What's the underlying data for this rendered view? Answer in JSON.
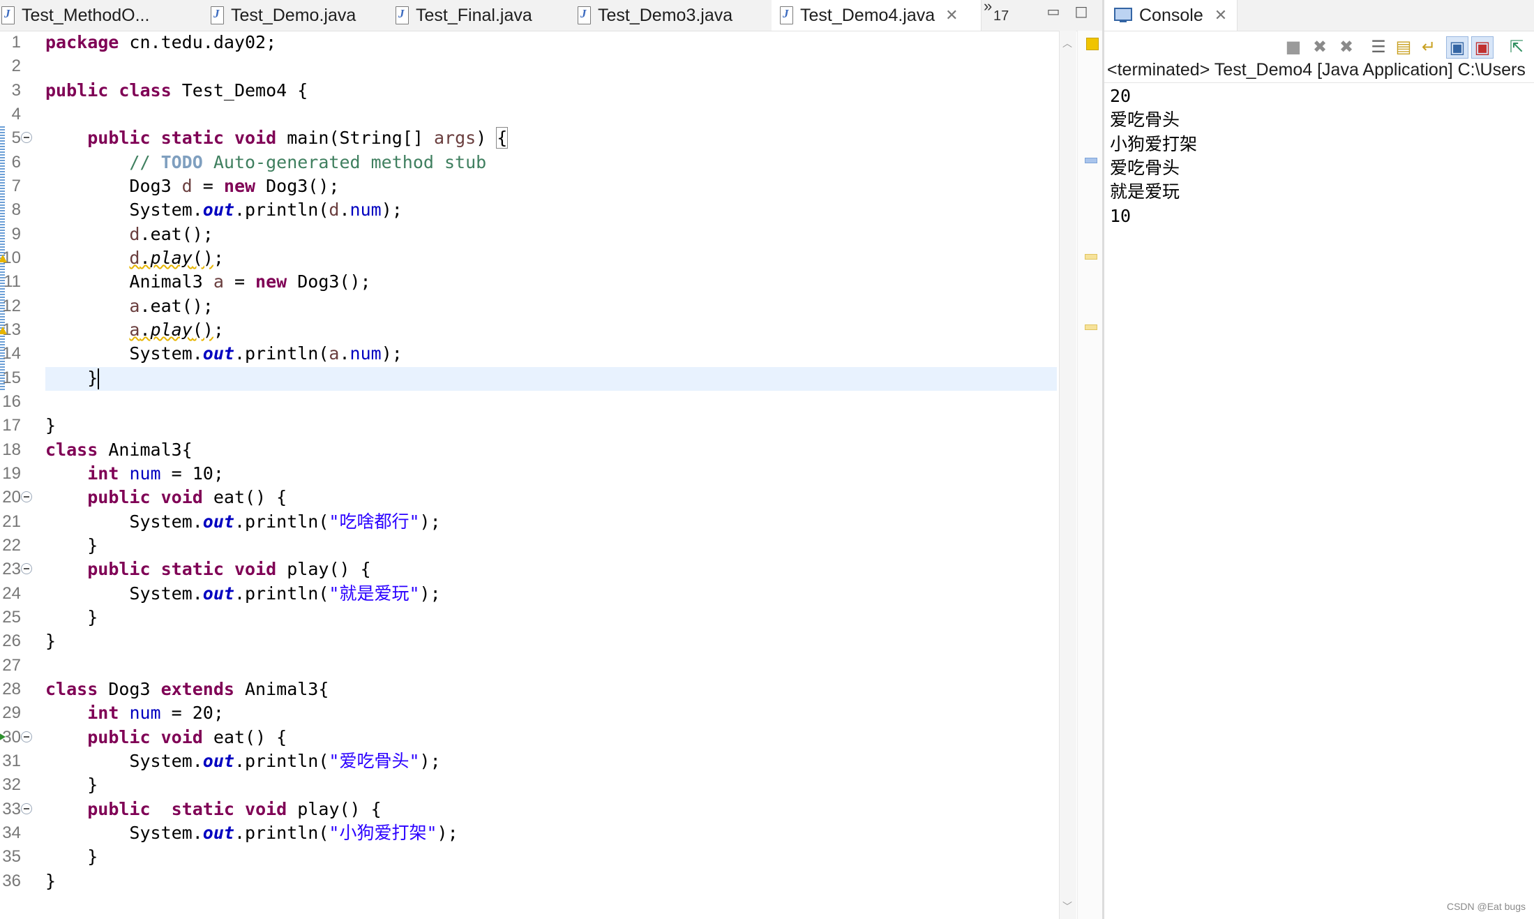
{
  "editor": {
    "tabs": [
      {
        "label": "Test_MethodO..."
      },
      {
        "label": "Test_Demo.java"
      },
      {
        "label": "Test_Final.java"
      },
      {
        "label": "Test_Demo3.java"
      },
      {
        "label": "Test_Demo4.java",
        "active": true
      }
    ],
    "overflow_glyph": "»",
    "overflow_count": "17",
    "code_lines": [
      "package cn.tedu.day02;",
      "",
      "public class Test_Demo4 {",
      "",
      "    public static void main(String[] args) {",
      "        // TODO Auto-generated method stub",
      "        Dog3 d = new Dog3();",
      "        System.out.println(d.num);",
      "        d.eat();",
      "        d.play();",
      "        Animal3 a = new Dog3();",
      "        a.eat();",
      "        a.play();",
      "        System.out.println(a.num);",
      "    }",
      "",
      "}",
      "class Animal3{",
      "    int num = 10;",
      "    public void eat() {",
      "        System.out.println(\"吃啥都行\");",
      "    }",
      "    public static void play() {",
      "        System.out.println(\"就是爱玩\");",
      "    }",
      "}",
      "",
      "class Dog3 extends Animal3{",
      "    int num = 20;",
      "    public void eat() {",
      "        System.out.println(\"爱吃骨头\");",
      "    }",
      "    public  static void play() {",
      "        System.out.println(\"小狗爱打架\");",
      "    }",
      "}"
    ],
    "current_line": 15
  },
  "console": {
    "tab_label": "Console",
    "status": "<terminated> Test_Demo4 [Java Application] C:\\Users",
    "output": [
      "20",
      "爱吃骨头",
      "小狗爱打架",
      "爱吃骨头",
      "就是爱玩",
      "10"
    ]
  },
  "watermark": "CSDN @Eat bugs",
  "colors": {
    "keyword": "#7f0055",
    "field": "#0000c0",
    "comment": "#3f7f5f",
    "string": "#2a00ff",
    "current_line_bg": "#e8f2fe",
    "warning": "#e6b400"
  },
  "icons": {
    "java_file": "java-file-icon",
    "console": "console-monitor-icon",
    "close": "close-icon",
    "terminate": "terminate-icon",
    "remove_launch": "remove-launch-icon",
    "remove_all": "remove-all-icon",
    "clear": "clear-console-icon",
    "scroll_lock": "scroll-lock-icon",
    "word_wrap": "word-wrap-icon",
    "show_on_output": "show-on-output-icon",
    "show_on_error": "show-on-error-icon",
    "pin": "pin-console-icon"
  }
}
